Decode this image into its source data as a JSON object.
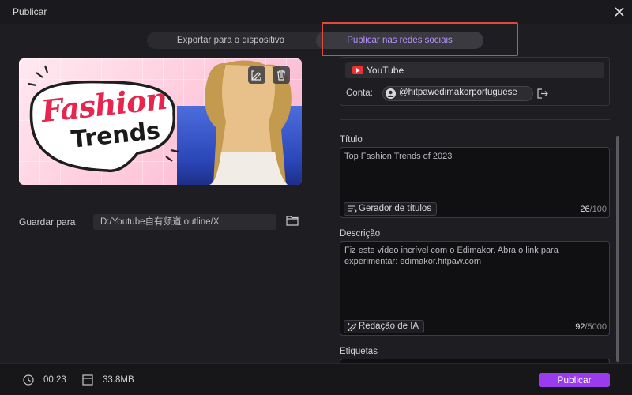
{
  "window": {
    "title": "Publicar"
  },
  "tabs": [
    {
      "label": "Exportar para o dispositivo"
    },
    {
      "label": "Publicar nas redes sociais",
      "active": true
    }
  ],
  "thumbnail": {
    "line1": "Fashion",
    "line2": "Trends",
    "accent": "#e8254f"
  },
  "save": {
    "label": "Guardar para",
    "path": "D:/Youtube自有频道 outline/X"
  },
  "platform": {
    "name": "YouTube",
    "account_label": "Conta:",
    "account": "@hitpawedimakorportuguese"
  },
  "title_field": {
    "label": "Título",
    "value": "Top Fashion Trends of 2023",
    "button": "Gerador de títulos",
    "count": "26",
    "max": "/100"
  },
  "description_field": {
    "label": "Descrição",
    "value": "Fiz este vídeo incrível com o Edimakor. Abra o link para experimentar: edimakor.hitpaw.com",
    "button": "Redação de IA",
    "count": "92",
    "max": "/5000"
  },
  "tags_field": {
    "label": "Etiquetas"
  },
  "footer": {
    "duration": "00:23",
    "size": "33.8MB",
    "publish": "Publicar"
  },
  "colors": {
    "accent": "#9b3bf0",
    "tab_active_text": "#b792ff",
    "highlight": "#e04a3c",
    "youtube": "#f03030"
  }
}
